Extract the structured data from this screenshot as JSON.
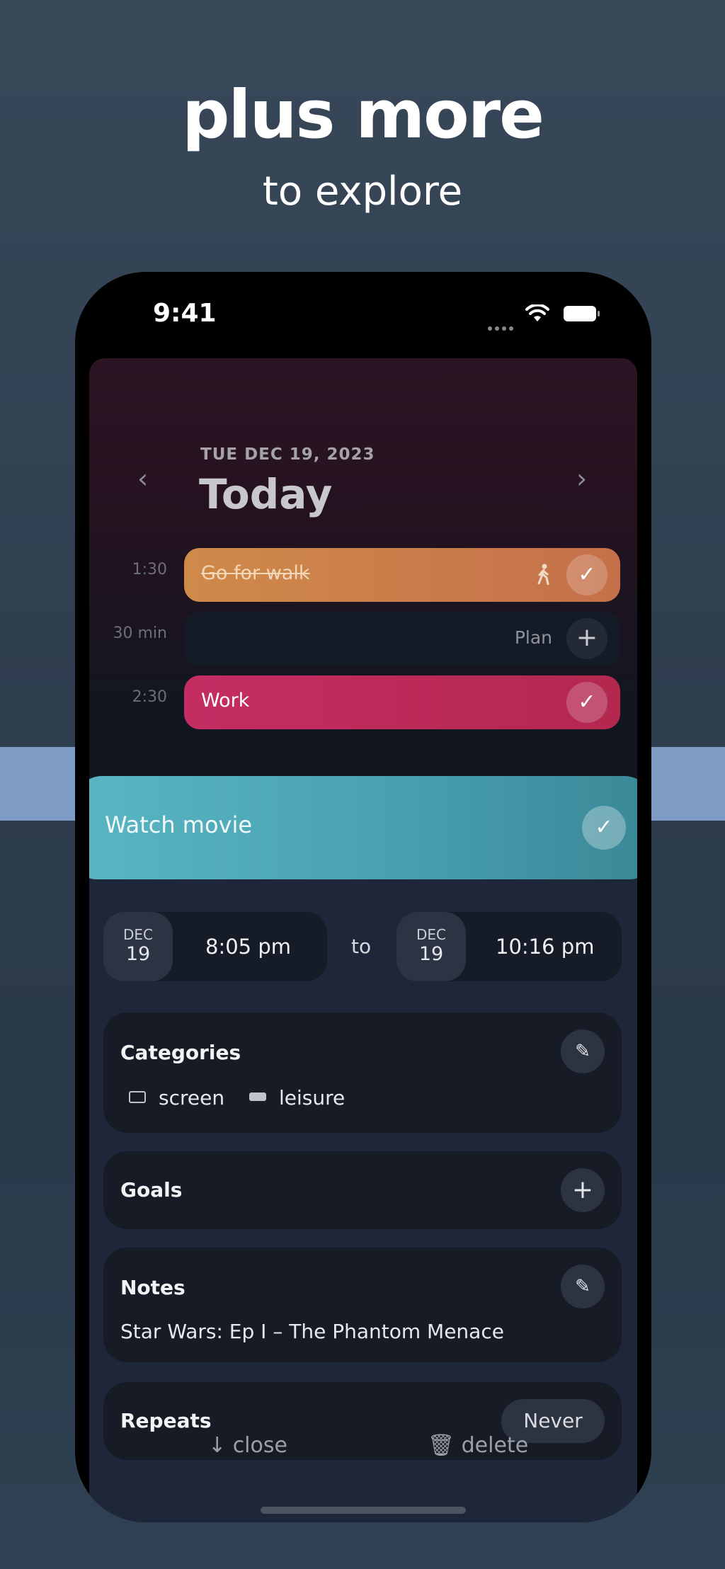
{
  "promo": {
    "headline": "plus more",
    "subline": "to explore"
  },
  "status_bar": {
    "time": "9:41"
  },
  "calendar": {
    "date": "TUE DEC 19, 2023",
    "title": "Today",
    "prev_icon": "chevron-left-icon",
    "next_icon": "chevron-right-icon",
    "rows": [
      {
        "time": "1:30",
        "title": "Go for walk",
        "icon": "walk-icon",
        "done": true,
        "color": "#cf8a4a"
      },
      {
        "time": "30 min",
        "plan_label": "Plan"
      },
      {
        "time": "2:30",
        "title": "Work",
        "icon": "briefcase-icon",
        "color": "#c42d63"
      }
    ]
  },
  "event": {
    "title": "Watch movie",
    "color": "#48a1b0",
    "start": {
      "month": "DEC",
      "day": "19",
      "time": "8:05 pm"
    },
    "separator": "to",
    "end": {
      "month": "DEC",
      "day": "19",
      "time": "10:16 pm"
    },
    "categories": {
      "title": "Categories",
      "items": [
        {
          "label": "screen",
          "icon": "monitor-icon"
        },
        {
          "label": "leisure",
          "icon": "sofa-icon"
        }
      ]
    },
    "goals": {
      "title": "Goals"
    },
    "notes": {
      "title": "Notes",
      "text": "Star Wars: Ep I – The Phantom Menace"
    },
    "repeats": {
      "title": "Repeats",
      "value": "Never"
    }
  },
  "actions": {
    "close": "close",
    "delete": "delete"
  }
}
